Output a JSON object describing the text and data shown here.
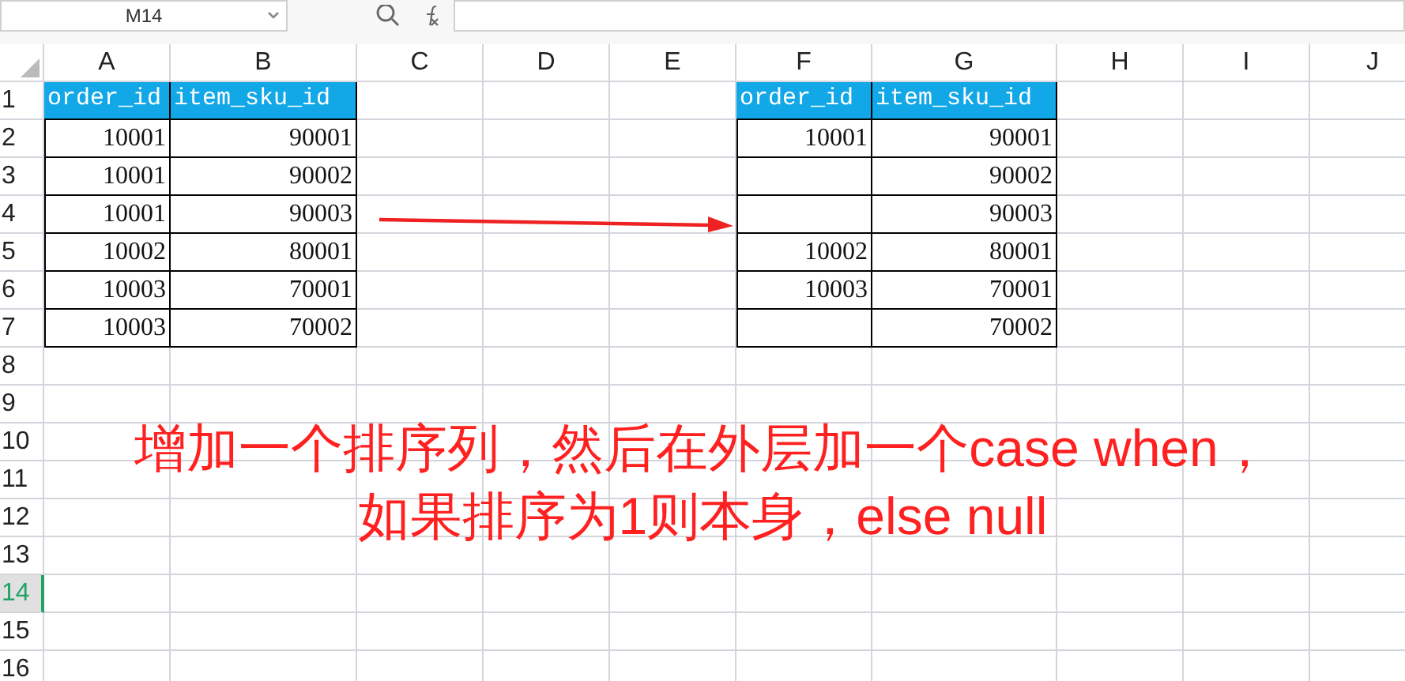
{
  "formula_bar": {
    "name_box": "M14"
  },
  "columns": [
    {
      "label": "A",
      "selected": false
    },
    {
      "label": "B",
      "selected": false
    },
    {
      "label": "C",
      "selected": false
    },
    {
      "label": "D",
      "selected": false
    },
    {
      "label": "E",
      "selected": false
    },
    {
      "label": "F",
      "selected": false
    },
    {
      "label": "G",
      "selected": false
    },
    {
      "label": "H",
      "selected": false
    },
    {
      "label": "I",
      "selected": false
    },
    {
      "label": "J",
      "selected": false
    }
  ],
  "rows": [
    {
      "label": "1",
      "selected": false
    },
    {
      "label": "2",
      "selected": false
    },
    {
      "label": "3",
      "selected": false
    },
    {
      "label": "4",
      "selected": false
    },
    {
      "label": "5",
      "selected": false
    },
    {
      "label": "6",
      "selected": false
    },
    {
      "label": "7",
      "selected": false
    },
    {
      "label": "8",
      "selected": false
    },
    {
      "label": "9",
      "selected": false
    },
    {
      "label": "10",
      "selected": false
    },
    {
      "label": "11",
      "selected": false
    },
    {
      "label": "12",
      "selected": false
    },
    {
      "label": "13",
      "selected": false
    },
    {
      "label": "14",
      "selected": true
    },
    {
      "label": "15",
      "selected": false
    },
    {
      "label": "16",
      "selected": false
    }
  ],
  "tables": [
    {
      "header": [
        "order_id",
        "item_sku_id"
      ],
      "rows": [
        [
          "10001",
          "90001"
        ],
        [
          "10001",
          "90002"
        ],
        [
          "10001",
          "90003"
        ],
        [
          "10002",
          "80001"
        ],
        [
          "10003",
          "70001"
        ],
        [
          "10003",
          "70002"
        ]
      ]
    },
    {
      "header": [
        "order_id",
        "item_sku_id"
      ],
      "rows": [
        [
          "10001",
          "90001"
        ],
        [
          null,
          "90002"
        ],
        [
          null,
          "90003"
        ],
        [
          "10002",
          "80001"
        ],
        [
          "10003",
          "70001"
        ],
        [
          null,
          "70002"
        ]
      ]
    }
  ],
  "annotation": [
    "增加一个排序列，然后在外层加一个case when，",
    "如果排序为1则本身，else null"
  ]
}
